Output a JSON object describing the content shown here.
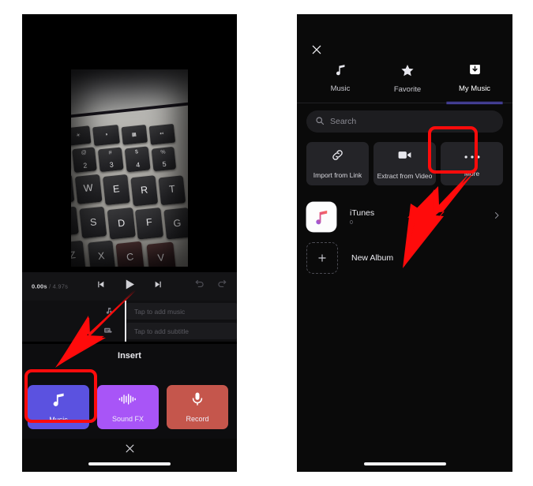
{
  "left_phone": {
    "player": {
      "current_time": "0.00s",
      "separator": "/",
      "total_time": "4.97s",
      "controls": [
        {
          "name": "skip-back-icon",
          "label": "Previous"
        },
        {
          "name": "play-icon",
          "label": "Play"
        },
        {
          "name": "skip-forward-icon",
          "label": "Next"
        }
      ],
      "history": [
        {
          "name": "undo-icon",
          "label": "Undo"
        },
        {
          "name": "redo-icon",
          "label": "Redo"
        }
      ]
    },
    "timeline": {
      "music_track_placeholder": "Tap to add music",
      "subtitle_track_placeholder": "Tap to add subtitle",
      "music_track_icon": "music-note-plus-icon",
      "subtitle_track_icon": "subtitle-plus-icon"
    },
    "insert_label": "Insert",
    "tiles": [
      {
        "label": "Music",
        "icon": "music-note-icon",
        "color": "#5b52e0"
      },
      {
        "label": "Sound FX",
        "icon": "waveform-icon",
        "color": "#a855f7"
      },
      {
        "label": "Record",
        "icon": "microphone-icon",
        "color": "#c5564c"
      }
    ],
    "close_icon": "close-icon"
  },
  "right_phone": {
    "close_icon": "close-icon",
    "tabs": [
      {
        "label": "Music",
        "icon": "music-note-icon",
        "active": false
      },
      {
        "label": "Favorite",
        "icon": "star-icon",
        "active": false
      },
      {
        "label": "My Music",
        "icon": "download-box-icon",
        "active": true
      }
    ],
    "search": {
      "placeholder": "Search",
      "icon": "search-icon"
    },
    "actions": [
      {
        "label": "Import from Link",
        "icon": "link-icon"
      },
      {
        "label": "Extract from Video",
        "icon": "video-camera-icon"
      },
      {
        "label": "More",
        "icon": "ellipsis-icon"
      }
    ],
    "albums": [
      {
        "title": "iTunes",
        "count": "0",
        "icon": "itunes-icon",
        "chevron": "chevron-right-icon"
      },
      {
        "title": "New Album",
        "icon": "plus-icon"
      }
    ]
  },
  "annotations": {
    "accent_red": "#ff0b0b",
    "highlights": [
      "music-tile",
      "more-button"
    ],
    "arrows": [
      "arrow-to-music-tile",
      "arrow-to-more-button"
    ]
  }
}
